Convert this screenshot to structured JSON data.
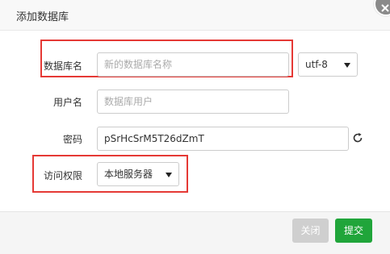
{
  "dialog": {
    "title": "添加数据库",
    "close_icon": "close-icon"
  },
  "form": {
    "db_name": {
      "label": "数据库名",
      "placeholder": "新的数据库名称",
      "value": ""
    },
    "charset": {
      "value": "utf-8"
    },
    "db_user": {
      "label": "用户名",
      "placeholder": "数据库用户",
      "value": ""
    },
    "password": {
      "label": "密码",
      "value": "pSrHcSrM5T26dZmT",
      "refresh_icon": "refresh-icon"
    },
    "access": {
      "label": "访问权限",
      "value": "本地服务器"
    }
  },
  "footer": {
    "close_label": "关闭",
    "submit_label": "提交"
  },
  "colors": {
    "primary": "#20a53a",
    "disabled": "#cfcfcf",
    "highlight": "#e53935"
  }
}
